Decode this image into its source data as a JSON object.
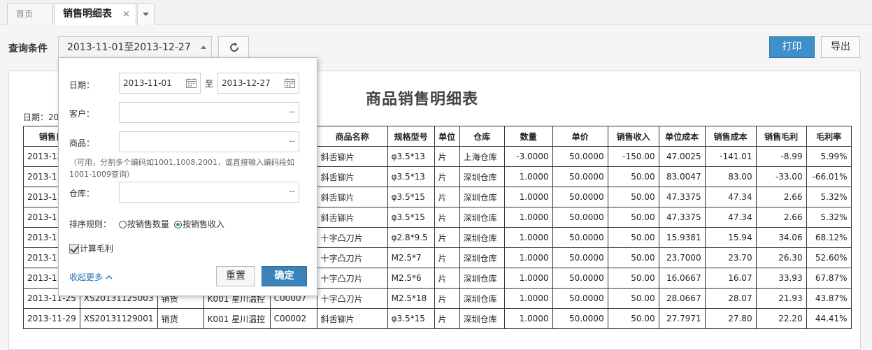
{
  "tabs": [
    {
      "label": "首页"
    },
    {
      "label": "销售明细表",
      "close": "×"
    }
  ],
  "toolbar": {
    "query_label": "查询条件",
    "date_range": "2013-11-01至2013-12-27",
    "print_label": "打印",
    "export_label": "导出"
  },
  "report": {
    "title": "商品销售明细表",
    "date_prefix": "日期：20",
    "columns": [
      "销售日",
      "",
      "",
      "",
      "",
      "商品名称",
      "规格型号",
      "单位",
      "仓库",
      "数量",
      "单价",
      "销售收入",
      "单位成本",
      "销售成本",
      "销售毛利",
      "毛利率"
    ],
    "rows": [
      [
        "2013-12",
        "",
        "",
        "",
        "",
        "斜舌铆片",
        "φ3.5*13",
        "片",
        "上海仓库",
        "-3.0000",
        "50.0000",
        "-150.00",
        "47.0025",
        "-141.01",
        "-8.99",
        "5.99%"
      ],
      [
        "2013-11",
        "",
        "",
        "",
        "",
        "斜舌铆片",
        "φ3.5*13",
        "片",
        "深圳仓库",
        "1.0000",
        "50.0000",
        "50.00",
        "83.0047",
        "83.00",
        "-33.00",
        "-66.01%"
      ],
      [
        "2013-11",
        "",
        "",
        "",
        "",
        "斜舌铆片",
        "φ3.5*15",
        "片",
        "深圳仓库",
        "1.0000",
        "50.0000",
        "50.00",
        "47.3375",
        "47.34",
        "2.66",
        "5.32%"
      ],
      [
        "2013-11",
        "",
        "",
        "",
        "",
        "斜舌铆片",
        "φ3.5*15",
        "片",
        "深圳仓库",
        "1.0000",
        "50.0000",
        "50.00",
        "47.3375",
        "47.34",
        "2.66",
        "5.32%"
      ],
      [
        "2013-11",
        "",
        "",
        "",
        "",
        "十字凸刀片",
        "φ2.8*9.5",
        "片",
        "深圳仓库",
        "1.0000",
        "50.0000",
        "50.00",
        "15.9381",
        "15.94",
        "34.06",
        "68.12%"
      ],
      [
        "2013-11",
        "",
        "",
        "",
        "",
        "十字凸刀片",
        "M2.5*7",
        "片",
        "深圳仓库",
        "1.0000",
        "50.0000",
        "50.00",
        "23.7000",
        "23.70",
        "26.30",
        "52.60%"
      ],
      [
        "2013-11",
        "",
        "",
        "",
        "",
        "十字凸刀片",
        "M2.5*6",
        "片",
        "深圳仓库",
        "1.0000",
        "50.0000",
        "50.00",
        "16.0667",
        "16.07",
        "33.93",
        "67.87%"
      ],
      [
        "2013-11-25",
        "XS20131125003",
        "销货",
        "K001 星川温控",
        "C00007",
        "十字凸刀片",
        "M2.5*18",
        "片",
        "深圳仓库",
        "1.0000",
        "50.0000",
        "50.00",
        "28.0667",
        "28.07",
        "21.93",
        "43.87%"
      ],
      [
        "2013-11-29",
        "XS20131129001",
        "销货",
        "K001 星川温控",
        "C00002",
        "斜舌铆片",
        "φ3.5*15",
        "片",
        "深圳仓库",
        "1.0000",
        "50.0000",
        "50.00",
        "27.7971",
        "27.80",
        "22.20",
        "44.41%"
      ]
    ]
  },
  "panel": {
    "date_label": "日期：",
    "date_from": "2013-11-01",
    "date_sep": "至",
    "date_to": "2013-12-27",
    "customer_label": "客户：",
    "product_label": "商品：",
    "product_hint": "（可用，分割多个编码如1001,1008,2001，或直接输入编码段如1001-1009查询）",
    "warehouse_label": "仓库：",
    "sort_label": "排序规则：",
    "sort_options": [
      {
        "label": "按销售数量",
        "selected": false
      },
      {
        "label": "按销售收入",
        "selected": true
      }
    ],
    "calc_margin_label": "计算毛利",
    "calc_margin_checked": true,
    "collapse_label": "收起更多",
    "reset_label": "重置",
    "confirm_label": "确定",
    "ellipsis": "···"
  },
  "colors": {
    "primary_button": "#3f8fca",
    "confirm_button": "#3a82b8",
    "link": "#2a6fb0",
    "radio_on": "#3aa84a"
  }
}
